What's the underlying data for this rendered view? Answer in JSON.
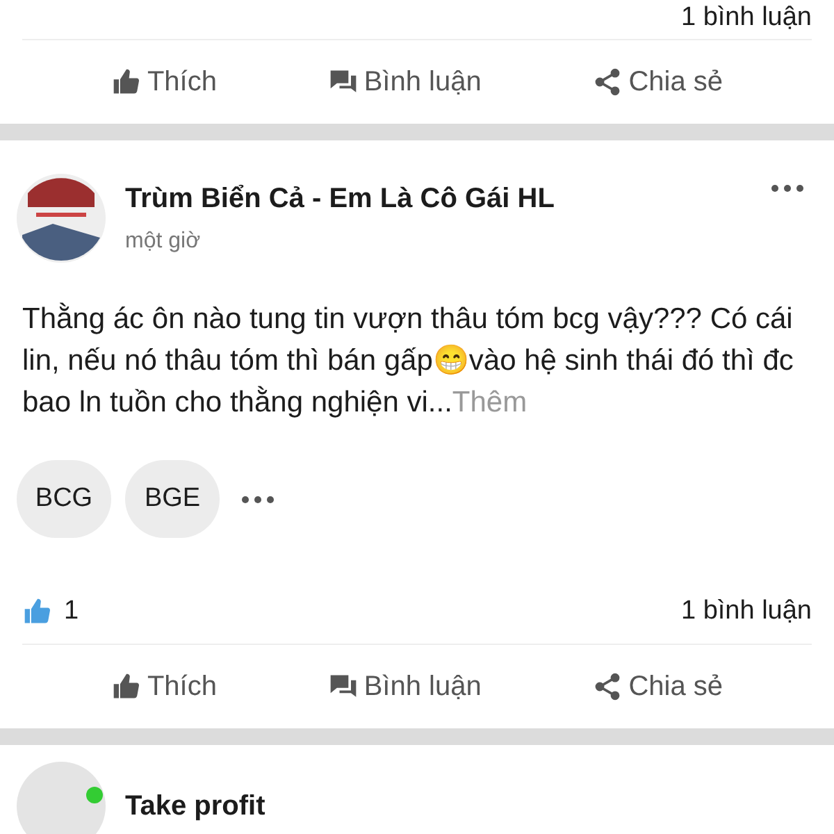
{
  "previous_post": {
    "comments": "1 bình luận",
    "actions": [
      {
        "kind": "like",
        "label": "Thích"
      },
      {
        "kind": "comment",
        "label": "Bình luận"
      },
      {
        "kind": "share",
        "label": "Chia sẻ"
      }
    ]
  },
  "post": {
    "author": "Trùm Biển Cả - Em Là Cô Gái HL",
    "time": "một giờ",
    "body": "Thằng ác ôn nào tung tin vượn thâu tóm bcg vậy??? Có cái lin, nếu nó thâu tóm thì bán gấp😁vào hệ sinh thái đó thì đc bao ln tuồn cho thằng nghiện vi...",
    "more": "Thêm",
    "tags": [
      "BCG",
      "BGE"
    ],
    "likes": "1",
    "comments": "1 bình luận",
    "actions": [
      {
        "kind": "like",
        "label": "Thích"
      },
      {
        "kind": "comment",
        "label": "Bình luận"
      },
      {
        "kind": "share",
        "label": "Chia sẻ"
      }
    ]
  },
  "next_post": {
    "author": "Take profit"
  }
}
